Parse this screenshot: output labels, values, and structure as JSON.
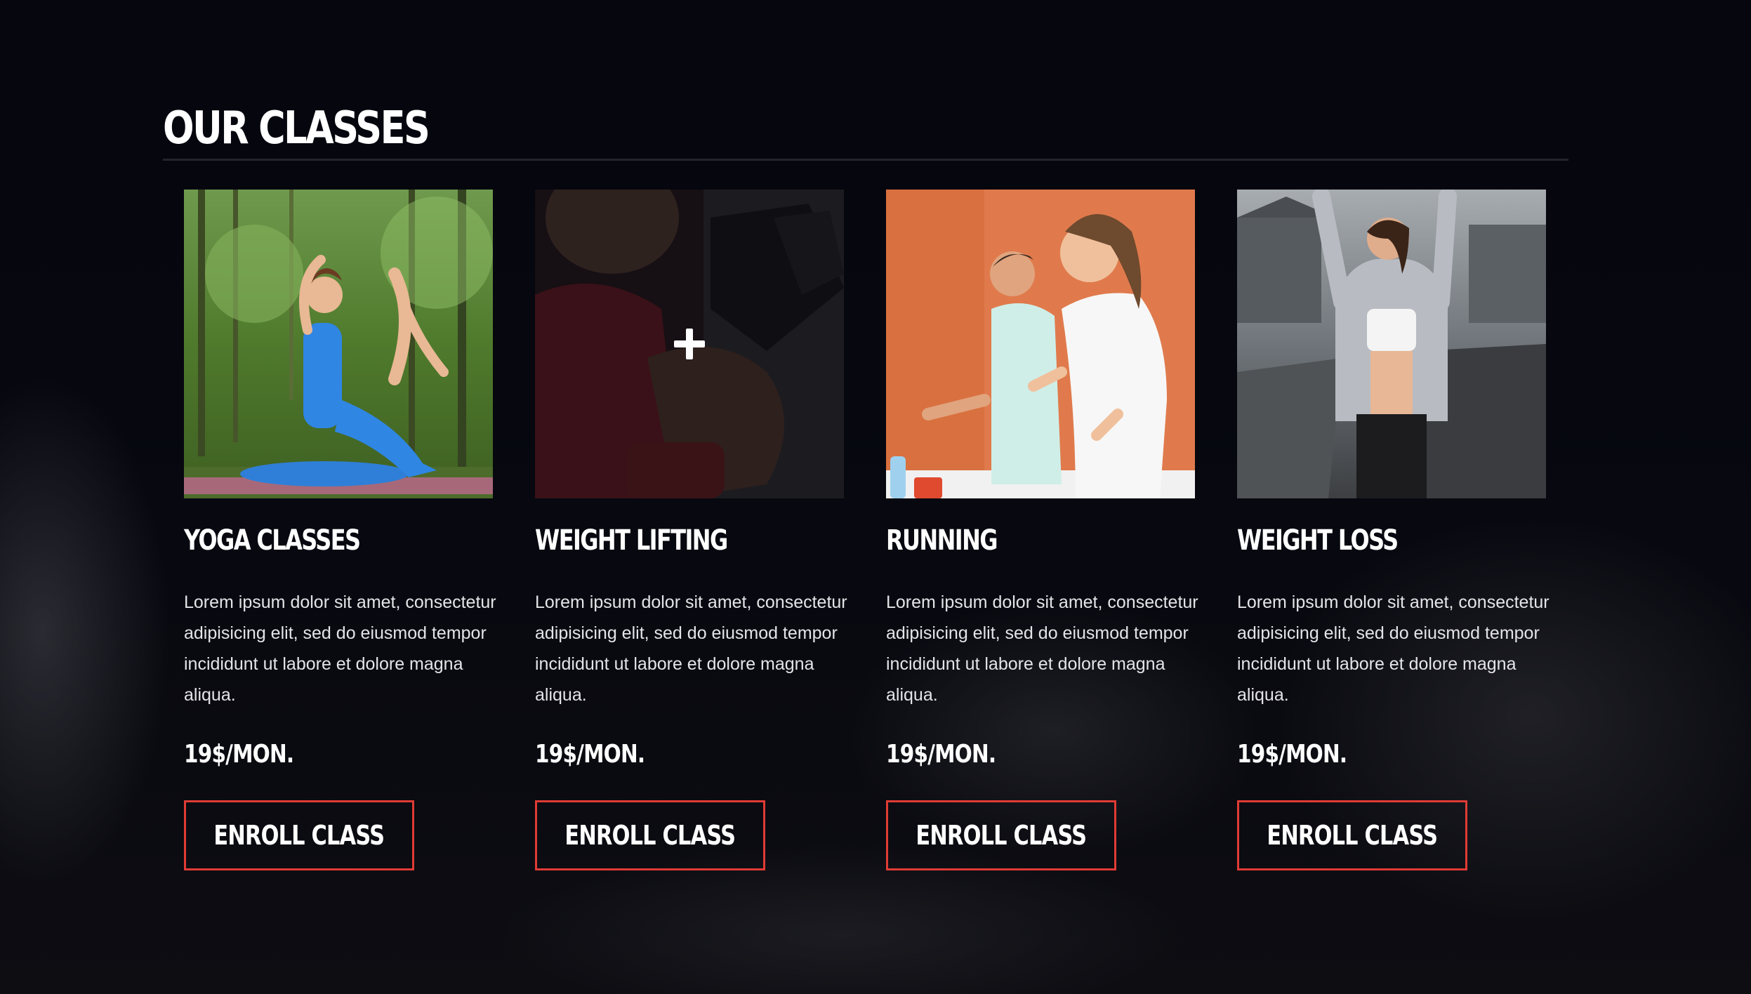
{
  "section": {
    "title": "OUR CLASSES"
  },
  "colors": {
    "background": "#06070f",
    "accent": "#e03b35",
    "text": "#ffffff",
    "rule": "#23242c"
  },
  "classes": [
    {
      "title": "YOGA CLASSES",
      "description": "Lorem ipsum dolor sit amet, consectetur adipisicing elit, sed do eiusmod tempor incididunt ut labore et dolore magna aliqua.",
      "price": "19$/MON.",
      "button_label": "ENROLL CLASS",
      "image": "yoga-photo"
    },
    {
      "title": "WEIGHT LIFTING",
      "description": "Lorem ipsum dolor sit amet, consectetur adipisicing elit, sed do eiusmod tempor incididunt ut labore et dolore magna aliqua.",
      "price": "19$/MON.",
      "button_label": "ENROLL CLASS",
      "image": "weight-lifting-photo",
      "hover_icon": "plus-icon"
    },
    {
      "title": "RUNNING",
      "description": "Lorem ipsum dolor sit amet, consectetur adipisicing elit, sed do eiusmod tempor incididunt ut labore et dolore magna aliqua.",
      "price": "19$/MON.",
      "button_label": "ENROLL CLASS",
      "image": "running-photo"
    },
    {
      "title": "WEIGHT LOSS",
      "description": "Lorem ipsum dolor sit amet, consectetur adipisicing elit, sed do eiusmod tempor incididunt ut labore et dolore magna aliqua.",
      "price": "19$/MON.",
      "button_label": "ENROLL CLASS",
      "image": "weight-loss-photo"
    }
  ]
}
